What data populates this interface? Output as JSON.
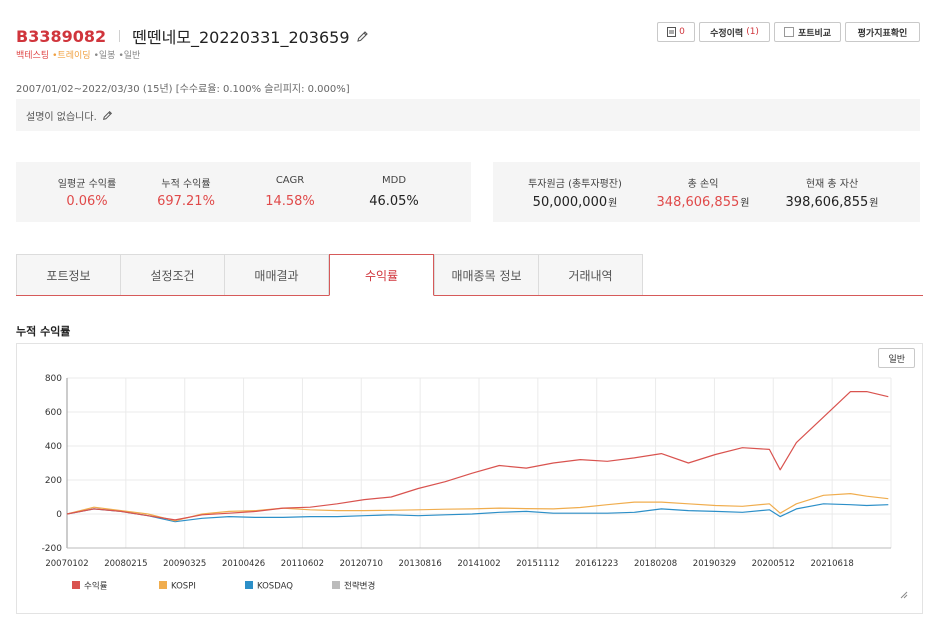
{
  "header": {
    "code": "B3389082",
    "title": "뗀뗀네모_20220331_203659",
    "tags": [
      "백테스팅",
      "•트레이딩",
      "•일봉",
      "•일반"
    ]
  },
  "top_buttons": {
    "save_count": "0",
    "revision_label": "수정이력",
    "revision_count": "(1)",
    "compare_label": "포트비교",
    "metric_label": "평가지표확인"
  },
  "period_text": "2007/01/02~2022/03/30 (15년) [수수료율: 0.100% 슬리피지: 0.000%]",
  "description": "설명이 없습니다.",
  "stats_left": [
    {
      "label": "일평균 수익률",
      "value": "0.06%"
    },
    {
      "label": "누적 수익률",
      "value": "697.21%"
    },
    {
      "label": "CAGR",
      "value": "14.58%"
    },
    {
      "label": "MDD",
      "value": "46.05%"
    }
  ],
  "stats_right": [
    {
      "label": "투자원금 (총투자평잔)",
      "value": "50,000,000",
      "unit": "원"
    },
    {
      "label": "총 손익",
      "value": "348,606,855",
      "unit": "원"
    },
    {
      "label": "현재 총 자산",
      "value": "398,606,855",
      "unit": "원"
    }
  ],
  "tabs": [
    "포트정보",
    "설정조건",
    "매매결과",
    "수익률",
    "매매종목 정보",
    "거래내역"
  ],
  "active_tab": "수익률",
  "section_title": "누적 수익률",
  "chart_mode_button": "일반",
  "colors": {
    "accent": "#d0353c",
    "return": "#d9534f",
    "kospi": "#f0ad4e",
    "kosdaq": "#2c8fc8",
    "strategy_change": "#bbbbbb"
  },
  "chart_data": {
    "type": "line",
    "ylim": [
      -200,
      800
    ],
    "yticks": [
      -200,
      0,
      200,
      400,
      600,
      800
    ],
    "xlabels": [
      "20070102",
      "20080215",
      "20090325",
      "20100426",
      "20110602",
      "20120710",
      "20130816",
      "20141002",
      "20151112",
      "20161223",
      "20180208",
      "20190329",
      "20200512",
      "20210618"
    ],
    "x": [
      2007.0,
      2007.5,
      2008.0,
      2008.5,
      2009.0,
      2009.5,
      2010.0,
      2010.5,
      2011.0,
      2011.5,
      2012.0,
      2012.5,
      2013.0,
      2013.5,
      2014.0,
      2014.5,
      2015.0,
      2015.5,
      2016.0,
      2016.5,
      2017.0,
      2017.5,
      2018.0,
      2018.5,
      2019.0,
      2019.5,
      2020.0,
      2020.2,
      2020.5,
      2021.0,
      2021.5,
      2021.8,
      2022.2
    ],
    "series": [
      {
        "name": "수익률",
        "values": [
          0,
          30,
          15,
          -10,
          -35,
          -5,
          5,
          15,
          35,
          40,
          60,
          85,
          100,
          150,
          190,
          240,
          285,
          270,
          300,
          320,
          310,
          330,
          355,
          300,
          350,
          390,
          380,
          260,
          420,
          570,
          720,
          720,
          690
        ]
      },
      {
        "name": "KOSPI",
        "values": [
          0,
          40,
          20,
          0,
          -40,
          0,
          15,
          20,
          35,
          25,
          20,
          20,
          22,
          25,
          28,
          30,
          35,
          32,
          30,
          38,
          55,
          70,
          70,
          60,
          50,
          45,
          60,
          5,
          60,
          110,
          120,
          105,
          90
        ]
      },
      {
        "name": "KOSDAQ",
        "values": [
          0,
          30,
          15,
          -10,
          -45,
          -25,
          -15,
          -20,
          -20,
          -15,
          -15,
          -10,
          -5,
          -10,
          -5,
          0,
          10,
          15,
          5,
          5,
          5,
          10,
          30,
          20,
          15,
          10,
          25,
          -15,
          30,
          60,
          55,
          50,
          55
        ]
      }
    ],
    "legend": [
      "수익률",
      "KOSPI",
      "KOSDAQ",
      "전략변경"
    ],
    "legend_position": "bottom-left",
    "grid": true
  }
}
